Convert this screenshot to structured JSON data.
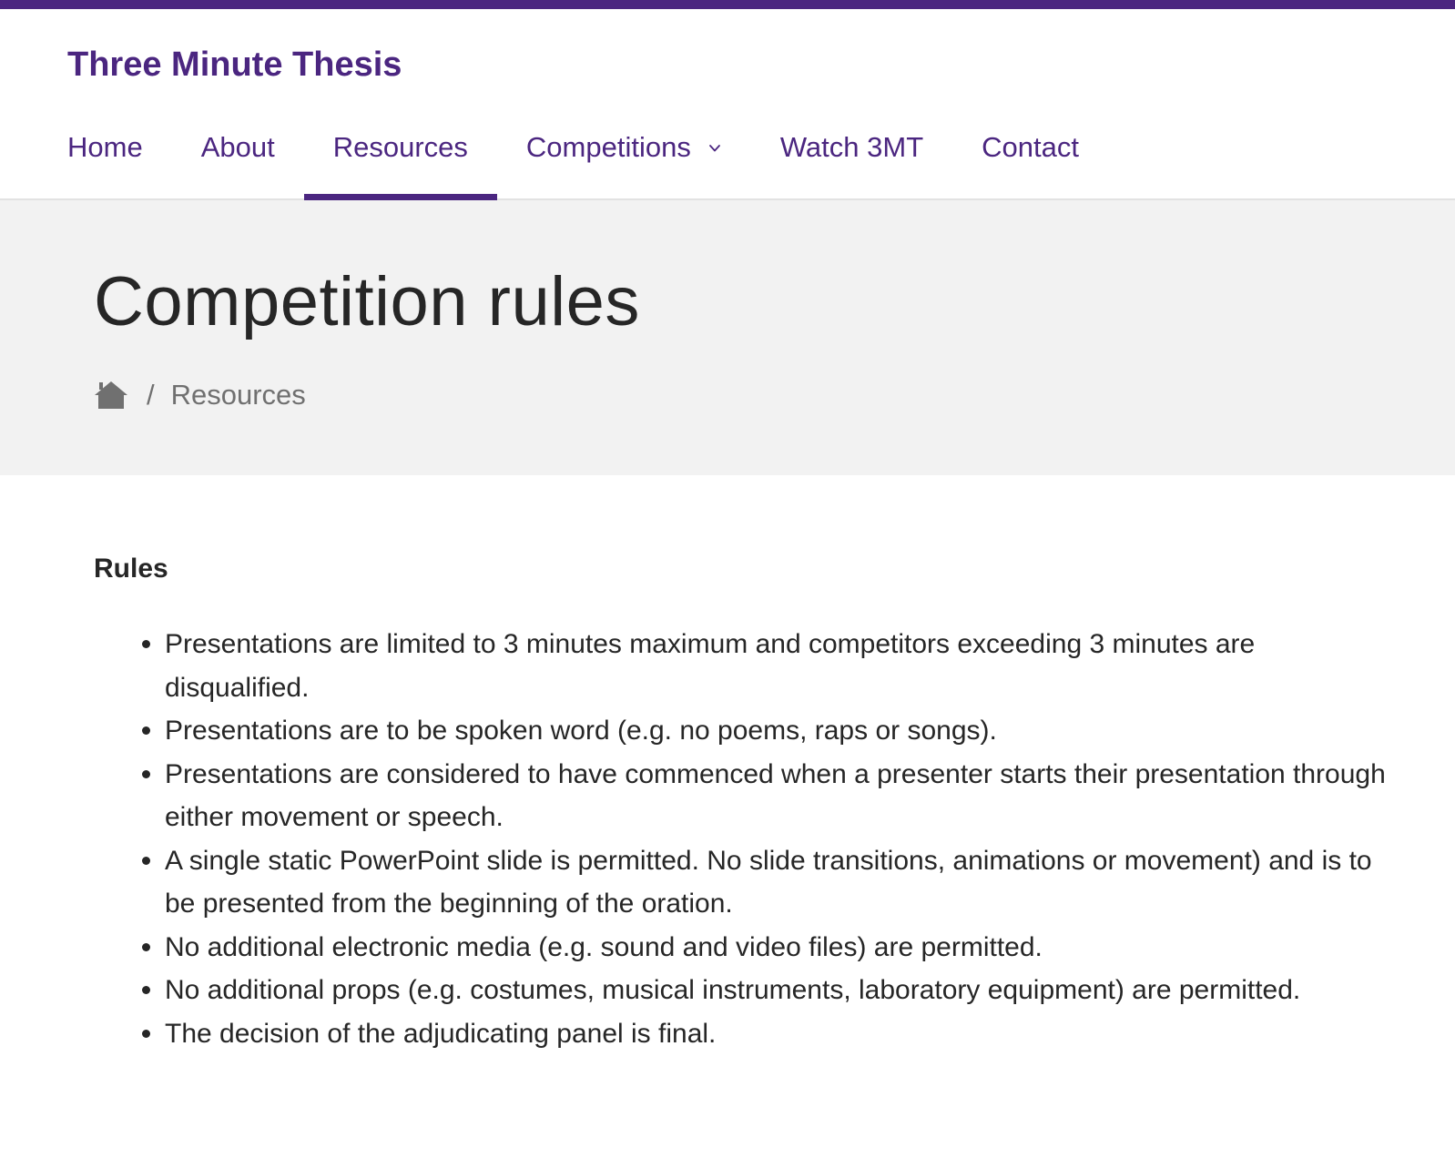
{
  "site": {
    "title": "Three Minute Thesis",
    "brand_color": "#4b2680"
  },
  "nav": {
    "items": [
      {
        "label": "Home"
      },
      {
        "label": "About"
      },
      {
        "label": "Resources",
        "active": true
      },
      {
        "label": "Competitions",
        "has_dropdown": true
      },
      {
        "label": "Watch 3MT"
      },
      {
        "label": "Contact"
      }
    ]
  },
  "hero": {
    "title": "Competition rules",
    "background": "#f2f2f2",
    "breadcrumb": {
      "home_icon": "home-icon",
      "separator": "/",
      "current": "Resources"
    }
  },
  "content": {
    "heading": "Rules",
    "rules": [
      "Presentations are limited to 3 minutes maximum and competitors exceeding 3 minutes are disqualified.",
      "Presentations are to be spoken word (e.g. no poems, raps or songs).",
      "Presentations are considered to have commenced when a presenter starts their presentation through either movement or speech.",
      "A single static PowerPoint slide is permitted. No slide transitions, animations or movement) and is to be presented from the beginning of the oration.",
      "No additional electronic media (e.g. sound and video files) are permitted.",
      "No additional props (e.g. costumes, musical instruments, laboratory equipment) are permitted.",
      "The decision of the adjudicating panel is final."
    ]
  }
}
